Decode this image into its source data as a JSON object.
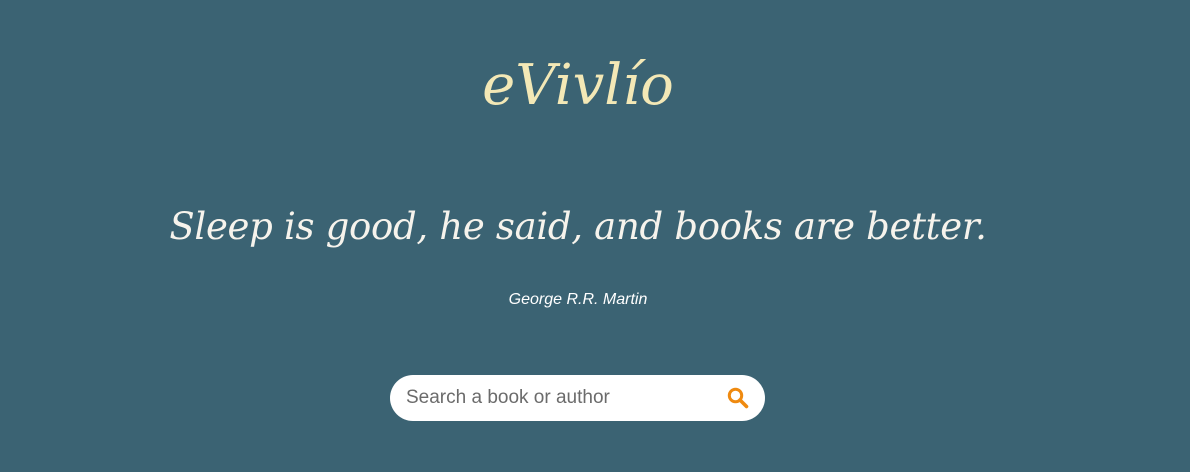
{
  "brand": {
    "title": "eVivlío"
  },
  "quote": {
    "text": "Sleep is good, he said, and books are better.",
    "author": "George R.R. Martin"
  },
  "search": {
    "placeholder": "Search a book or author",
    "value": "",
    "icon": "search-icon"
  },
  "colors": {
    "background": "#3b6373",
    "brand": "#f3e8b6",
    "quote": "#f6f3ec",
    "search_icon": "#ef8a10"
  }
}
